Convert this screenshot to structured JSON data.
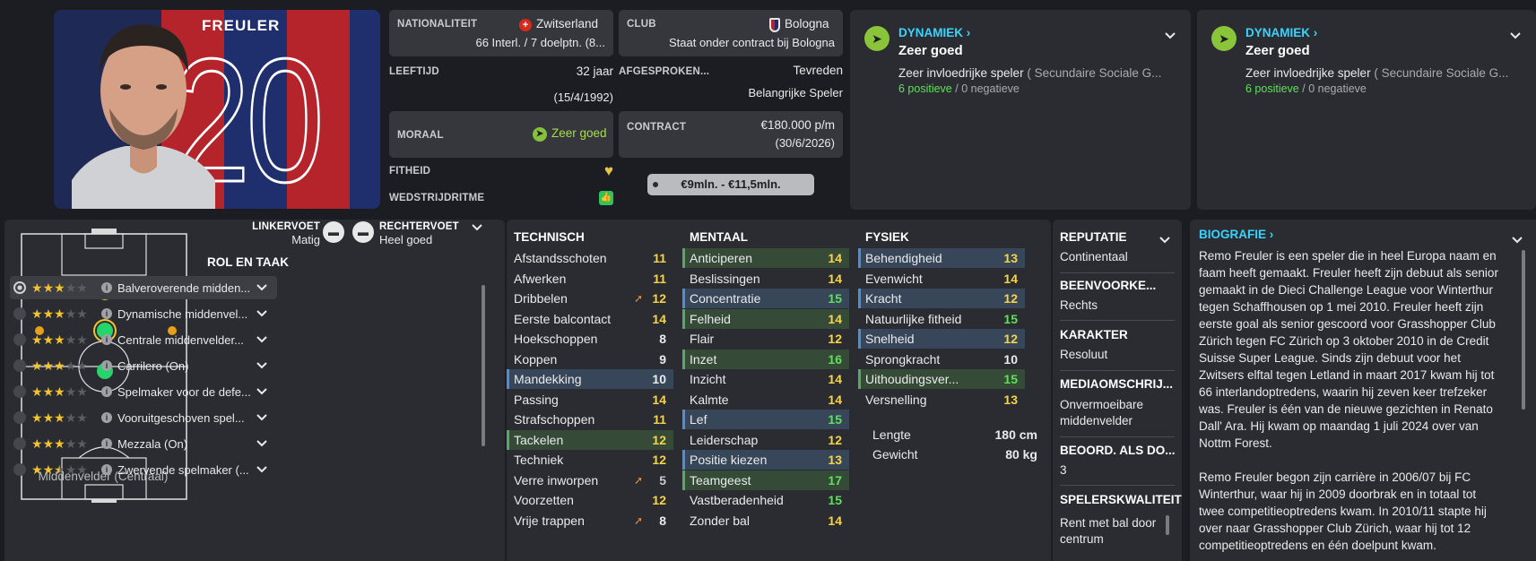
{
  "player": {
    "surname": "FREULER",
    "shirt_number": "20"
  },
  "info": {
    "nationality_label": "NATIONALITEIT",
    "nationality_value": "Zwitserland",
    "nationality_caps": "66 Interl. / 7 doelptn. (8...",
    "club_label": "CLUB",
    "club_value": "Bologna",
    "club_status": "Staat onder contract bij Bologna",
    "age_label": "LEEFTIJD",
    "age_value": "32 jaar",
    "dob": "(15/4/1992)",
    "agreed_label": "AFGESPROKEN...",
    "agreed_value": "Tevreden",
    "agreed_role": "Belangrijke Speler",
    "morale_label": "MORAAL",
    "morale_value": "Zeer goed",
    "contract_label": "CONTRACT",
    "contract_wage": "€180.000 p/m",
    "contract_end": "(30/6/2026)",
    "fitness_label": "FITHEID",
    "match_fitness_label": "WEDSTRIJDRITME",
    "value_range": "€9mln. - €11,5mln."
  },
  "dynamics": [
    {
      "title": "DYNAMIEK",
      "rating": "Zeer goed",
      "desc": "Zeer invloedrijke speler",
      "desc_group": "( Secundaire Sociale G...",
      "positive": "6 positieve",
      "sep": "/",
      "negative": "0 negatieve"
    },
    {
      "title": "DYNAMIEK",
      "rating": "Zeer goed",
      "desc": "Zeer invloedrijke speler",
      "desc_group": "( Secundaire Sociale G...",
      "positive": "6 positieve",
      "sep": "/",
      "negative": "0 negatieve"
    }
  ],
  "feet": {
    "left_label": "LINKERVOET",
    "left_value": "Matig",
    "right_label": "RECHTERVOET",
    "right_value": "Heel goed"
  },
  "position_label": "Middenvelder (Centraal)",
  "roles_header": "ROL EN TAAK",
  "roles": [
    {
      "name": "Balveroverende midden...",
      "stars": 3
    },
    {
      "name": "Dynamische middenvel...",
      "stars": 3
    },
    {
      "name": "Centrale middenvelder...",
      "stars": 3
    },
    {
      "name": "Carrilero (On)",
      "stars": 3
    },
    {
      "name": "Spelmaker voor de defe...",
      "stars": 3
    },
    {
      "name": "Vooruitgeschoven spel...",
      "stars": 3
    },
    {
      "name": "Mezzala (On)",
      "stars": 3
    },
    {
      "name": "Zwervende spelmaker (...",
      "stars": 2.5
    }
  ],
  "technical": {
    "header": "TECHNISCH",
    "rows": [
      {
        "name": "Afstandsschoten",
        "value": "11",
        "hl": ""
      },
      {
        "name": "Afwerken",
        "value": "11",
        "hl": ""
      },
      {
        "name": "Dribbelen",
        "value": "12",
        "hl": "",
        "trend": "up"
      },
      {
        "name": "Eerste balcontact",
        "value": "14",
        "hl": ""
      },
      {
        "name": "Hoekschoppen",
        "value": "8",
        "hl": ""
      },
      {
        "name": "Koppen",
        "value": "9",
        "hl": ""
      },
      {
        "name": "Mandekking",
        "value": "10",
        "hl": "blue"
      },
      {
        "name": "Passing",
        "value": "14",
        "hl": ""
      },
      {
        "name": "Strafschoppen",
        "value": "11",
        "hl": ""
      },
      {
        "name": "Tackelen",
        "value": "12",
        "hl": "green"
      },
      {
        "name": "Techniek",
        "value": "12",
        "hl": ""
      },
      {
        "name": "Verre inworpen",
        "value": "5",
        "hl": "",
        "trend": "up"
      },
      {
        "name": "Voorzetten",
        "value": "12",
        "hl": ""
      },
      {
        "name": "Vrije trappen",
        "value": "8",
        "hl": "",
        "trend": "up"
      }
    ]
  },
  "mental": {
    "header": "MENTAAL",
    "rows": [
      {
        "name": "Anticiperen",
        "value": "14",
        "hl": "green"
      },
      {
        "name": "Beslissingen",
        "value": "14",
        "hl": ""
      },
      {
        "name": "Concentratie",
        "value": "15",
        "hl": "blue"
      },
      {
        "name": "Felheid",
        "value": "14",
        "hl": "green"
      },
      {
        "name": "Flair",
        "value": "12",
        "hl": ""
      },
      {
        "name": "Inzet",
        "value": "16",
        "hl": "green"
      },
      {
        "name": "Inzicht",
        "value": "14",
        "hl": ""
      },
      {
        "name": "Kalmte",
        "value": "14",
        "hl": ""
      },
      {
        "name": "Lef",
        "value": "15",
        "hl": "blue"
      },
      {
        "name": "Leiderschap",
        "value": "12",
        "hl": ""
      },
      {
        "name": "Positie kiezen",
        "value": "13",
        "hl": "blue"
      },
      {
        "name": "Teamgeest",
        "value": "17",
        "hl": "green"
      },
      {
        "name": "Vastberadenheid",
        "value": "15",
        "hl": ""
      },
      {
        "name": "Zonder bal",
        "value": "14",
        "hl": ""
      }
    ]
  },
  "physical": {
    "header": "FYSIEK",
    "rows": [
      {
        "name": "Behendigheid",
        "value": "13",
        "hl": "blue"
      },
      {
        "name": "Evenwicht",
        "value": "14",
        "hl": ""
      },
      {
        "name": "Kracht",
        "value": "12",
        "hl": "blue"
      },
      {
        "name": "Natuurlijke fitheid",
        "value": "15",
        "hl": ""
      },
      {
        "name": "Snelheid",
        "value": "12",
        "hl": "blue"
      },
      {
        "name": "Sprongkracht",
        "value": "10",
        "hl": ""
      },
      {
        "name": "Uithoudingsver...",
        "value": "15",
        "hl": "green"
      },
      {
        "name": "Versnelling",
        "value": "13",
        "hl": ""
      }
    ],
    "height_label": "Lengte",
    "height_value": "180 cm",
    "weight_label": "Gewicht",
    "weight_value": "80 kg"
  },
  "profile": {
    "reputation_label": "REPUTATIE",
    "reputation_value": "Continentaal",
    "foot_pref_label": "BEENVOORKE...",
    "foot_pref_value": "Rechts",
    "character_label": "KARAKTER",
    "character_value": "Resoluut",
    "media_label": "MEDIAOMSCHRIJ...",
    "media_value": "Onvermoeibare middenvelder",
    "rated_as_label": "BEOORD. ALS DO...",
    "rated_as_value": "3",
    "traits_label": "SPELERSKWALITEIT",
    "traits_value": "Rent met bal door centrum"
  },
  "bio": {
    "title": "BIOGRAFIE",
    "p1": "Remo Freuler is een speler die in heel Europa naam en faam heeft gemaakt. Freuler heeft zijn debuut als senior gemaakt in de Dieci Challenge League voor Winterthur tegen Schaffhousen op 1 mei 2010. Freuler heeft zijn eerste goal als senior gescoord voor Grasshopper Club Zürich tegen FC Zürich op 3 oktober 2010 in de Credit Suisse Super League. Sinds zijn debuut voor het Zwitsers elftal tegen Letland in maart 2017 kwam hij tot 66 interlandoptredens, waarin hij zeven keer trefzeker was. Freuler is één van de nieuwe gezichten in Renato Dall' Ara. Hij kwam op maandag 1 juli 2024 over van Nottm Forest.",
    "p2": "Remo Freuler begon zijn carrière in 2006/07 bij FC Winterthur, waar hij in 2009 doorbrak en in totaal tot twee competitieoptredens kwam. In 2010/11 stapte hij over naar Grasshopper Club Zürich, waar hij tot 12 competitieoptredens en één doelpunt kwam."
  },
  "colors": {
    "accent": "#3ad3ff",
    "good": "#5ee05a",
    "stars": "#f2c230",
    "highlight_green": "#354a37",
    "highlight_blue": "#374759"
  }
}
